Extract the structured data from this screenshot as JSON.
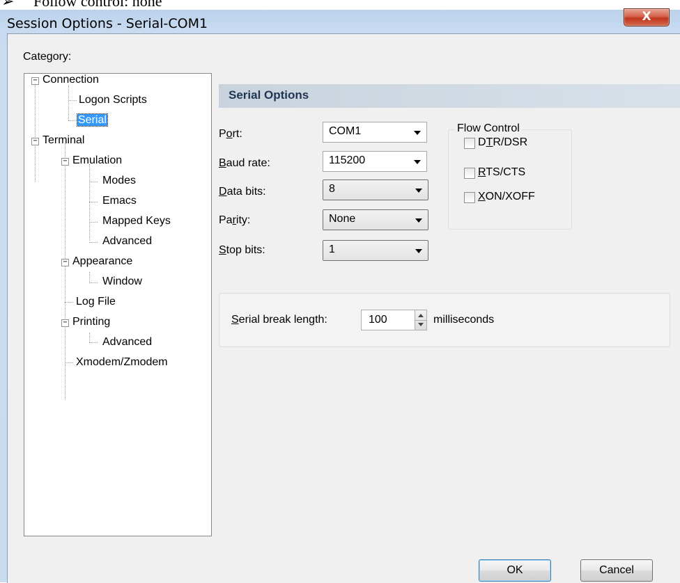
{
  "document": {
    "bullet": "➢",
    "text": "Follow control: none"
  },
  "window": {
    "title": "Session Options - Serial-COM1",
    "close_label": "X"
  },
  "category": {
    "label": "Category:"
  },
  "tree": {
    "connection": "Connection",
    "logon_scripts": "Logon Scripts",
    "serial": "Serial",
    "terminal": "Terminal",
    "emulation": "Emulation",
    "modes": "Modes",
    "emacs": "Emacs",
    "mapped_keys": "Mapped Keys",
    "advanced_emulation": "Advanced",
    "appearance": "Appearance",
    "window": "Window",
    "log_file": "Log File",
    "printing": "Printing",
    "advanced_printing": "Advanced",
    "xmodem": "Xmodem/Zmodem",
    "expander_symbol": "−"
  },
  "serial_options": {
    "header": "Serial Options",
    "port": {
      "label_pre": "P",
      "label_u": "o",
      "label_post": "rt:",
      "value": "COM1"
    },
    "baud_rate": {
      "label_pre": "",
      "label_u": "B",
      "label_post": "aud rate:",
      "value": "115200"
    },
    "data_bits": {
      "label_pre": "",
      "label_u": "D",
      "label_post": "ata bits:",
      "value": "8"
    },
    "parity": {
      "label_pre": "Pa",
      "label_u": "r",
      "label_post": "ity:",
      "value": "None"
    },
    "stop_bits": {
      "label_pre": "",
      "label_u": "S",
      "label_post": "top bits:",
      "value": "1"
    }
  },
  "flow_control": {
    "title": "Flow Control",
    "dtr_dsr": {
      "pre": "D",
      "u": "T",
      "post": "R/DSR",
      "checked": false
    },
    "rts_cts": {
      "pre": "",
      "u": "R",
      "post": "TS/CTS",
      "checked": false
    },
    "xon_xoff": {
      "pre": "",
      "u": "X",
      "post": "ON/XOFF",
      "checked": false
    }
  },
  "serial_break": {
    "label_pre": "",
    "label_u": "S",
    "label_post": "erial break length:",
    "value": "100",
    "unit": "milliseconds"
  },
  "buttons": {
    "ok": "OK",
    "cancel": "Cancel"
  }
}
